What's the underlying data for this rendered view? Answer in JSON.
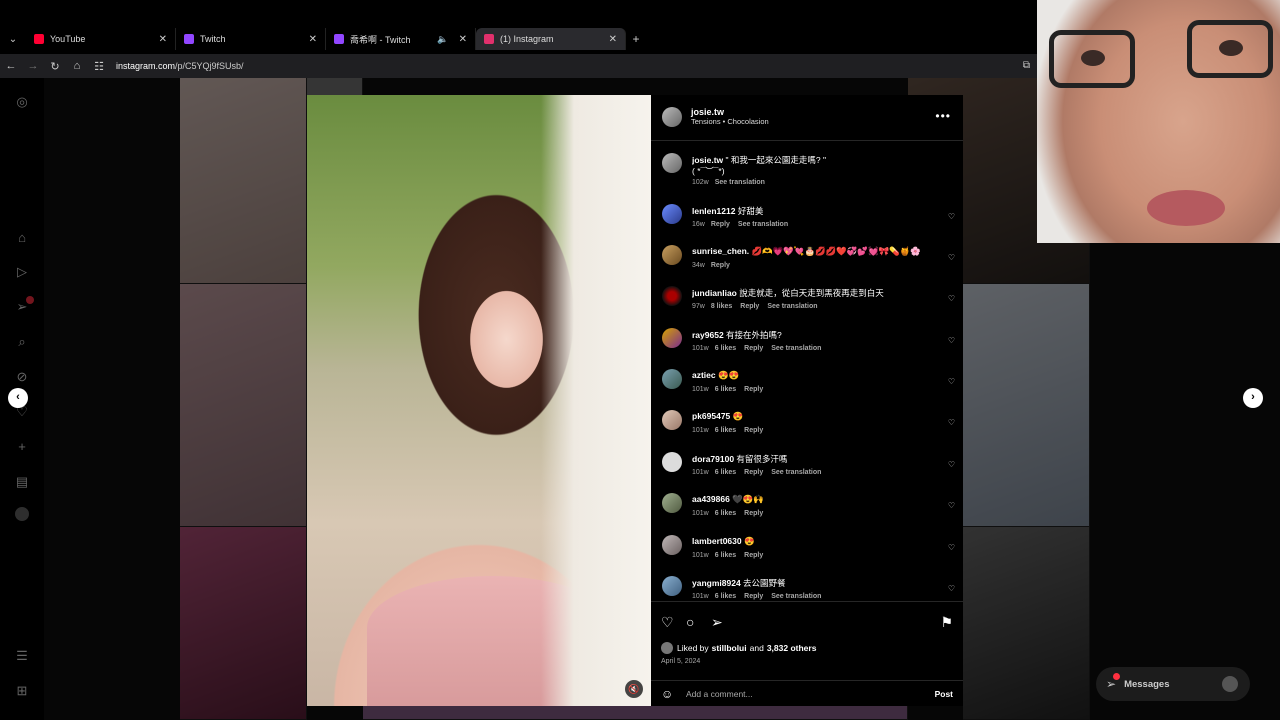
{
  "browser": {
    "tabs": [
      {
        "title": "YouTube",
        "favicon_color": "#ff0033",
        "active": false,
        "audio": false
      },
      {
        "title": "Twitch",
        "favicon_color": "#9146ff",
        "active": false,
        "audio": false
      },
      {
        "title": "喬希啊 - Twitch",
        "favicon_color": "#9146ff",
        "active": false,
        "audio": true
      },
      {
        "title": "(1) Instagram",
        "favicon_color": "#e1306c",
        "active": true,
        "audio": false
      }
    ],
    "url_domain": "instagram.com",
    "url_path": "/p/C5YQj9fSUsb/"
  },
  "post": {
    "author": "josie.tw",
    "audio": "Tensions • Chocolasion",
    "caption_user": "josie.tw",
    "caption_text": " \" 和我一起來公園走走嗎? \"",
    "caption_line2": "( *¯︶¯*)",
    "caption_time": "102w",
    "see_translation": "See translation",
    "liked_by_user": "stillbolui",
    "liked_and": "Liked by",
    "liked_others": "and",
    "liked_count": "3,832 others",
    "date": "April 5, 2024",
    "add_comment_placeholder": "Add a comment...",
    "post_label": "Post"
  },
  "comments": [
    {
      "user": "lenlen1212",
      "text": " 好甜美",
      "time": "16w",
      "likes": "",
      "reply": "Reply",
      "translate": "See translation"
    },
    {
      "user": "sunrise_chen.",
      "text": " 💋🫶💗💖💘🎂💋💋❤️💞💕💓🎀💊🍯🌸",
      "time": "34w",
      "likes": "",
      "reply": "Reply",
      "translate": ""
    },
    {
      "user": "jundianliao",
      "text": " 說走就走，從白天走到黑夜再走到白天",
      "time": "97w",
      "likes": "8 likes",
      "reply": "Reply",
      "translate": "See translation"
    },
    {
      "user": "ray9652",
      "text": " 有接在外拍嗎?",
      "time": "101w",
      "likes": "6 likes",
      "reply": "Reply",
      "translate": "See translation"
    },
    {
      "user": "aztiec",
      "text": " 😍😍",
      "time": "101w",
      "likes": "6 likes",
      "reply": "Reply",
      "translate": ""
    },
    {
      "user": "pk695475",
      "text": " 😍",
      "time": "101w",
      "likes": "6 likes",
      "reply": "Reply",
      "translate": ""
    },
    {
      "user": "dora79100",
      "text": " 有留很多汗嗎",
      "time": "101w",
      "likes": "6 likes",
      "reply": "Reply",
      "translate": "See translation"
    },
    {
      "user": "aa439866",
      "text": " 🖤😍🙌",
      "time": "101w",
      "likes": "6 likes",
      "reply": "Reply",
      "translate": ""
    },
    {
      "user": "lambert0630",
      "text": " 😍",
      "time": "101w",
      "likes": "6 likes",
      "reply": "Reply",
      "translate": ""
    },
    {
      "user": "yangmi8924",
      "text": " 去公園野餐",
      "time": "101w",
      "likes": "6 likes",
      "reply": "Reply",
      "translate": "See translation"
    }
  ],
  "messages": {
    "label": "Messages"
  },
  "colors": {
    "accent_red": "#ff3040",
    "panel_bg": "#000000",
    "muted_text": "#a8a8a8"
  }
}
